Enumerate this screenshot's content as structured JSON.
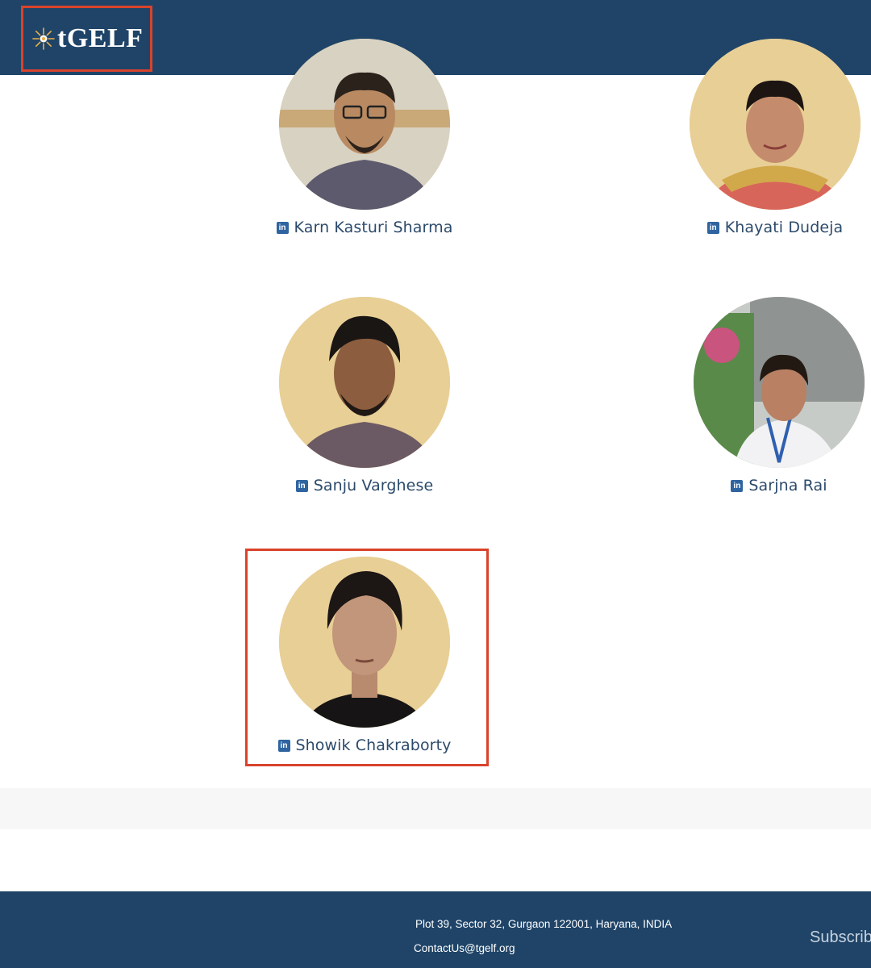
{
  "header": {
    "logo_text": "tGELF"
  },
  "members": [
    {
      "name": "Karn Kasturi Sharma",
      "linkedin_icon": "linkedin-icon"
    },
    {
      "name": "Khayati Dudeja",
      "linkedin_icon": "linkedin-icon"
    },
    {
      "name": "Sanju Varghese",
      "linkedin_icon": "linkedin-icon"
    },
    {
      "name": "Sarjna Rai",
      "linkedin_icon": "linkedin-icon"
    },
    {
      "name": "Showik Chakraborty",
      "linkedin_icon": "linkedin-icon"
    }
  ],
  "linkedin_glyph": "in",
  "footer": {
    "address": "Plot 39, Sector 32, Gurgaon 122001, Haryana, INDIA",
    "email": "ContactUs@tgelf.org",
    "subscribe": "Subscrib"
  },
  "colors": {
    "brand_navy": "#1f4468",
    "highlight_red": "#d9432b",
    "photo_bg": "#e8cf96",
    "name_text": "#2c4a6b",
    "linkedin_blue": "#2f64a0"
  }
}
